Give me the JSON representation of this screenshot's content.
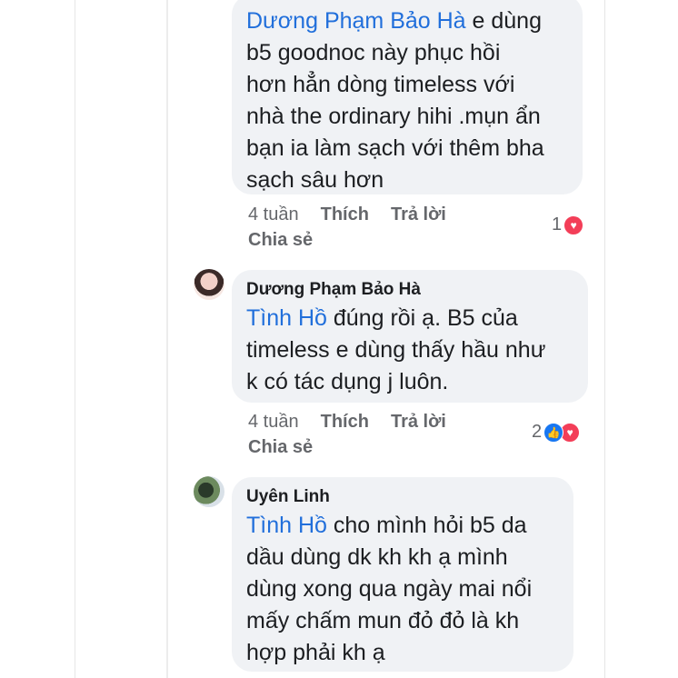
{
  "comments": [
    {
      "author": "",
      "mention": "Dương Phạm Bảo Hà",
      "text": " e dùng\nb5 goodnoc này phục hồi\nhơn hẳn dòng timeless với\nnhà the ordinary hihi .mụn ẩn\nbạn ia làm sạch với thêm bha\nsạch sâu hơn",
      "time": "4 tuần",
      "like": "Thích",
      "reply": "Trả lời",
      "share": "Chia sẻ",
      "reaction_count": "1",
      "reactions": [
        "love"
      ]
    },
    {
      "author": "Dương Phạm Bảo Hà",
      "mention": "Tình Hồ",
      "text": " đúng rồi ạ. B5 của\ntimeless e dùng thấy hầu như\nk có tác dụng j luôn.",
      "time": "4 tuần",
      "like": "Thích",
      "reply": "Trả lời",
      "share": "Chia sẻ",
      "reaction_count": "2",
      "reactions": [
        "like",
        "love"
      ]
    },
    {
      "author": "Uyên Linh",
      "mention": "Tình Hồ",
      "text": " cho mình hỏi b5 da\ndầu dùng dk kh kh ạ mình\ndùng xong qua ngày mai nổi\nmấy chấm mun đỏ đỏ là kh\nhợp phải kh ạ"
    }
  ],
  "icons": {
    "love": "heart-reaction-icon",
    "like": "thumbs-up-reaction-icon"
  },
  "colors": {
    "mention": "#216fdb",
    "bubble": "#f0f2f5",
    "meta": "#65676b",
    "love": "#f33e58",
    "like": "#1877f2"
  }
}
